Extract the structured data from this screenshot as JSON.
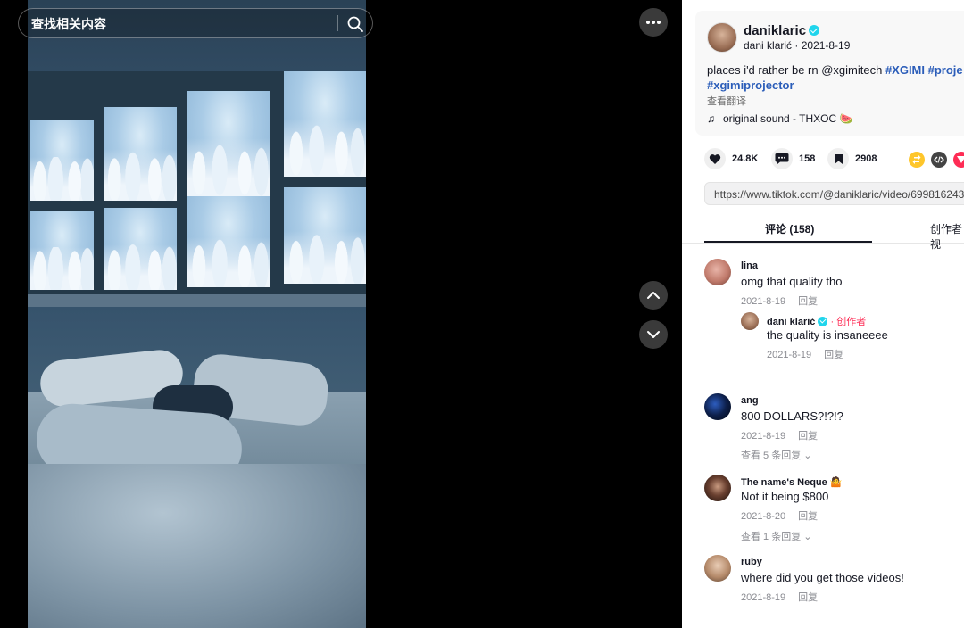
{
  "search": {
    "placeholder": "查找相关内容"
  },
  "post": {
    "username": "daniklaric",
    "subline": "dani klarić · 2021-8-19",
    "description_prefix": "places i'd rather be rn @xgimitech ",
    "tags": [
      "#XGIMI",
      "#proje",
      "#xgimiprojector"
    ],
    "translate": "查看翻译",
    "sound": "original sound - THXOC 🍉"
  },
  "actions": {
    "likes": "24.8K",
    "comments": "158",
    "saves": "2908"
  },
  "share_colors": {
    "repost": "#fec62b",
    "embed": "#444444",
    "send": "#fe2c55"
  },
  "link": {
    "url": "https://www.tiktok.com/@daniklaric/video/699816243..."
  },
  "tabs": {
    "comments": "评论 (158)",
    "creator": "创作者视"
  },
  "comments": [
    {
      "name": "lina",
      "text": "omg that quality tho",
      "date": "2021-8-19",
      "reply": "回复",
      "replies": [
        {
          "name": "dani klarić",
          "tag": "· 创作者",
          "text": "the quality is insaneeee",
          "date": "2021-8-19",
          "reply": "回复"
        }
      ]
    },
    {
      "name": "ang",
      "text": "800 DOLLARS?!?!?",
      "date": "2021-8-19",
      "reply": "回复",
      "more": "查看 5 条回复 ⌄"
    },
    {
      "name": "The name's Neque 🤷",
      "text": "Not it being $800",
      "date": "2021-8-20",
      "reply": "回复",
      "more": "查看 1 条回复 ⌄"
    },
    {
      "name": "ruby",
      "text": "where did you get those videos!",
      "date": "2021-8-19",
      "reply": "回复"
    }
  ],
  "icons": {
    "search": "search-icon",
    "more": "more-icon",
    "up": "chevron-up-icon",
    "down": "chevron-down-icon"
  }
}
